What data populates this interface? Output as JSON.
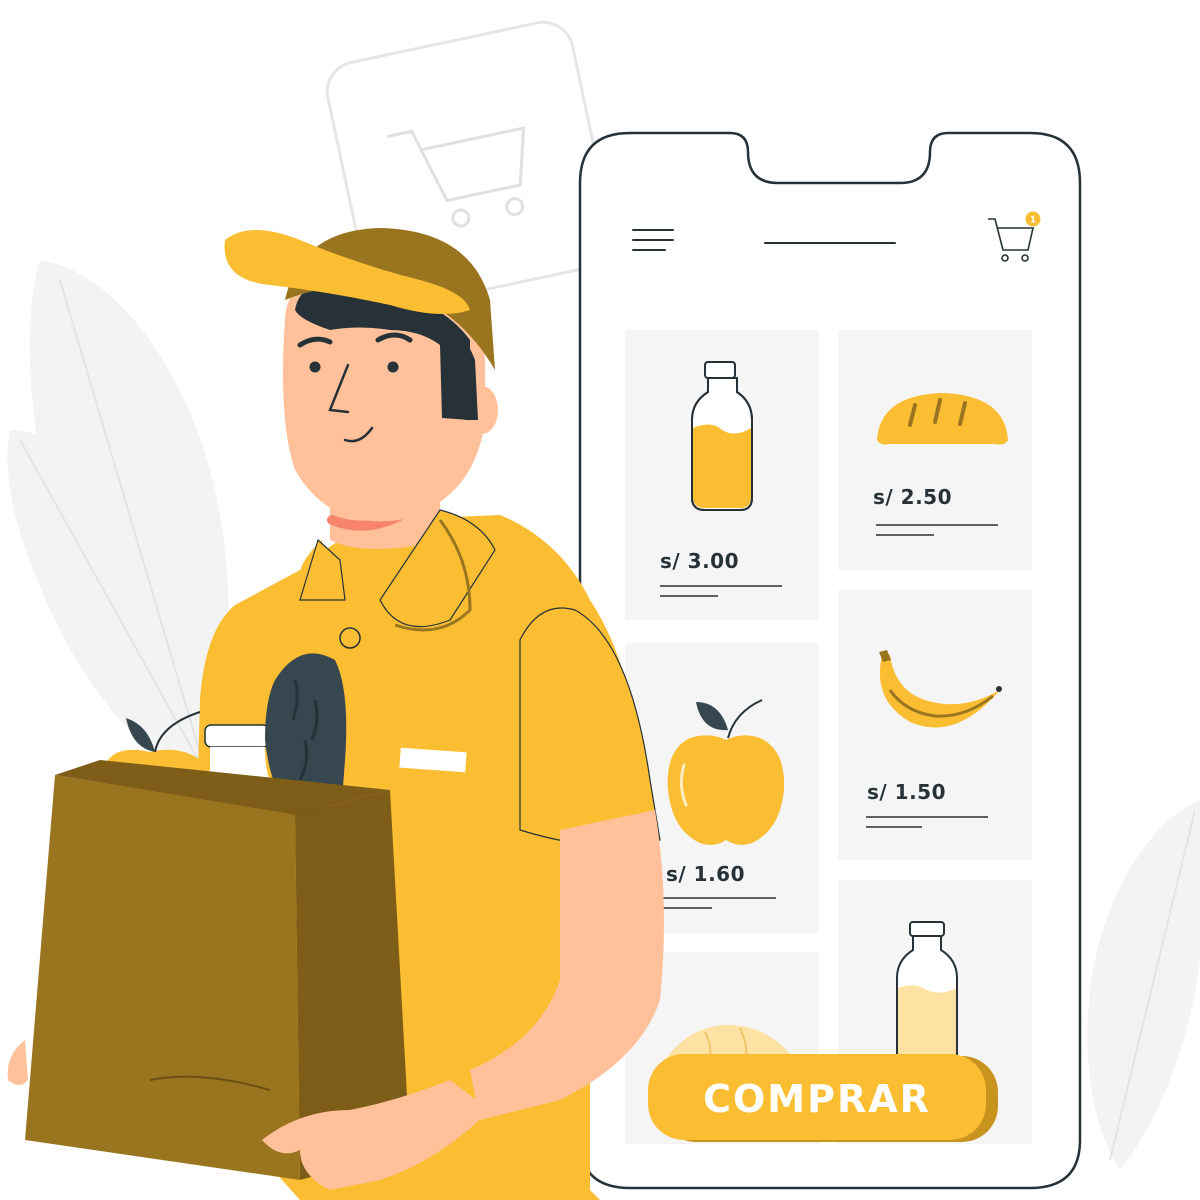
{
  "colors": {
    "accent": "#fbbe33",
    "accent_dark": "#9a7520",
    "skin": "#ffc09a",
    "dark": "#263238",
    "panel": "#f5f5f5",
    "outline": "#37474f"
  },
  "cart": {
    "badge_count": "1"
  },
  "products": [
    {
      "price": "s/ 3.00",
      "icon": "juice-bottle-icon"
    },
    {
      "price": "s/ 2.50",
      "icon": "bread-icon"
    },
    {
      "price": "s/ 1.60",
      "icon": "apple-icon"
    },
    {
      "price": "s/ 1.50",
      "icon": "banana-icon"
    },
    {
      "price": "",
      "icon": "bun-icon"
    },
    {
      "price": "",
      "icon": "milk-bottle-icon"
    }
  ],
  "buy_button": {
    "label": "COMPRAR"
  }
}
